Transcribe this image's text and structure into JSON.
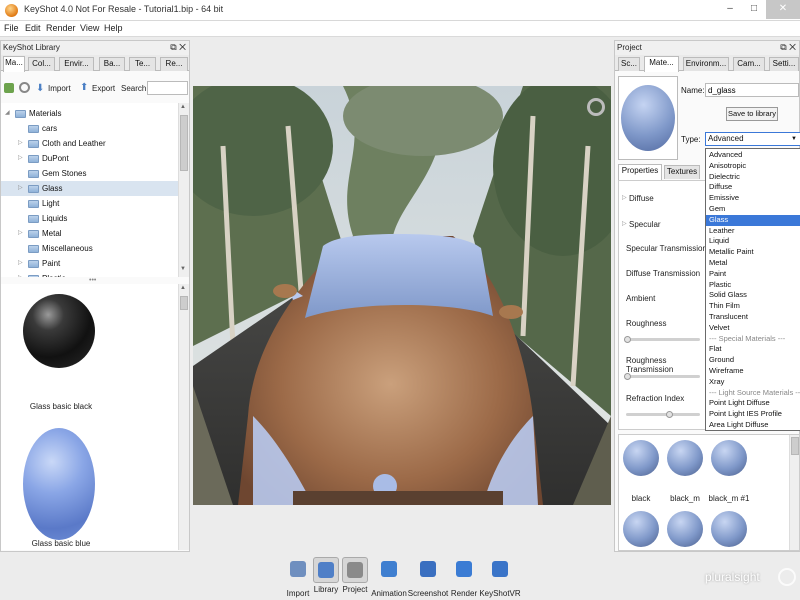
{
  "window": {
    "title": "KeyShot 4.0 Not For Resale - Tutorial1.bip - 64 bit",
    "minimize": "–",
    "maximize": "□",
    "close": "✕"
  },
  "menu": [
    "File",
    "Edit",
    "Render",
    "View",
    "Help"
  ],
  "library": {
    "title": "KeyShot Library",
    "tabs": [
      "Ma...",
      "Col...",
      "Envir...",
      "Ba...",
      "Te...",
      "Re..."
    ],
    "toolbar": {
      "import": "Import",
      "export": "Export",
      "search_label": "Search:",
      "search_value": ""
    },
    "tree_root": "Materials",
    "tree": [
      {
        "label": "cars",
        "expandable": false
      },
      {
        "label": "Cloth and Leather",
        "expandable": true
      },
      {
        "label": "DuPont",
        "expandable": true
      },
      {
        "label": "Gem Stones",
        "expandable": false
      },
      {
        "label": "Glass",
        "expandable": true
      },
      {
        "label": "Light",
        "expandable": false
      },
      {
        "label": "Liquids",
        "expandable": false
      },
      {
        "label": "Metal",
        "expandable": true
      },
      {
        "label": "Miscellaneous",
        "expandable": false
      },
      {
        "label": "Paint",
        "expandable": true
      },
      {
        "label": "Plastic",
        "expandable": true
      }
    ],
    "selected_folder": "Glass",
    "thumbnails": [
      {
        "name": "Glass basic black",
        "color": "#1b1b1b"
      },
      {
        "name": "Glass basic blue",
        "color": "#6f8fd6"
      }
    ]
  },
  "project": {
    "title": "Project",
    "tabs": [
      "Sc...",
      "Mate...",
      "Environm...",
      "Cam...",
      "Setti..."
    ],
    "name_label": "Name:",
    "name_value": "d_glass",
    "save_button": "Save to library",
    "type_label": "Type:",
    "type_value": "Advanced",
    "subtabs": [
      "Properties",
      "Textures"
    ],
    "properties": [
      "Diffuse",
      "Specular",
      "Specular Transmission",
      "Diffuse Transmission",
      "Ambient",
      "Roughness",
      "Roughness Transmission",
      "Refraction Index"
    ],
    "type_options": [
      "Advanced",
      "Anisotropic",
      "Dielectric",
      "Diffuse",
      "Emissive",
      "Gem",
      "Glass",
      "Leather",
      "Liquid",
      "Metallic Paint",
      "Metal",
      "Paint",
      "Plastic",
      "Solid Glass",
      "Thin Film",
      "Translucent",
      "Velvet",
      "--- Special Materials ---",
      "Flat",
      "Ground",
      "Wireframe",
      "Xray",
      "--- Light Source Materials ---",
      "Point Light Diffuse",
      "Point Light IES Profile",
      "Area Light Diffuse"
    ],
    "type_highlighted": "Glass",
    "materials": [
      "black",
      "black_m",
      "black_m #1",
      "",
      "",
      ""
    ]
  },
  "bottom_toolbar": [
    {
      "label": "Import",
      "icon": "import-icon",
      "active": false
    },
    {
      "label": "Library",
      "icon": "library-icon",
      "active": true
    },
    {
      "label": "Project",
      "icon": "project-icon",
      "active": true
    },
    {
      "label": "Animation",
      "icon": "animation-icon",
      "active": false
    },
    {
      "label": "Screenshot",
      "icon": "screenshot-icon",
      "active": false
    },
    {
      "label": "Render",
      "icon": "render-icon",
      "active": false
    },
    {
      "label": "KeyShotVR",
      "icon": "keyshotvr-icon",
      "active": false
    }
  ],
  "watermark": "pluralsight",
  "colors": {
    "accent": "#3b78d8",
    "car_body": "#a8744f",
    "glass_blue": "#7f98c9"
  }
}
